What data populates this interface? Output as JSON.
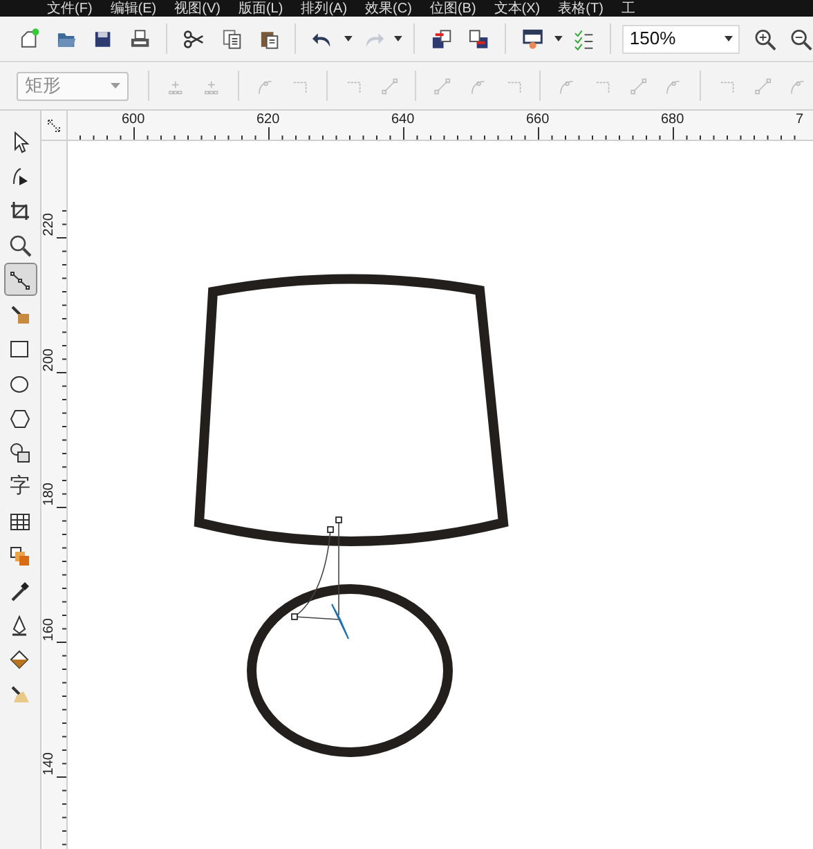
{
  "menu_bar": {
    "items": [
      "文件(F)",
      "编辑(E)",
      "视图(V)",
      "版面(L)",
      "排列(A)",
      "效果(C)",
      "位图(B)",
      "文本(X)",
      "表格(T)",
      "工"
    ]
  },
  "standard_toolbar": {
    "zoom": "150%"
  },
  "property_bar": {
    "shape": "矩形"
  },
  "horizontal_ruler": {
    "labels": [
      "600",
      "620",
      "640",
      "660",
      "680",
      "7"
    ]
  },
  "vertical_ruler": {
    "labels": [
      "220",
      "200",
      "180",
      "160",
      "140"
    ]
  },
  "toolbox": {
    "items": [
      {
        "kind": "icon",
        "selected": false
      },
      {
        "kind": "icon",
        "selected": false
      },
      {
        "kind": "icon",
        "selected": false
      },
      {
        "kind": "icon",
        "selected": false
      },
      {
        "kind": "icon",
        "selected": true
      },
      {
        "kind": "icon",
        "selected": false
      },
      {
        "kind": "icon",
        "selected": false
      },
      {
        "kind": "icon",
        "selected": false
      },
      {
        "kind": "icon",
        "selected": false
      },
      {
        "kind": "icon",
        "selected": false
      },
      {
        "kind": "glyph",
        "label": "字",
        "selected": false
      },
      {
        "kind": "icon",
        "selected": false
      },
      {
        "kind": "icon",
        "selected": false
      },
      {
        "kind": "icon",
        "selected": false
      },
      {
        "kind": "icon",
        "selected": false
      },
      {
        "kind": "icon",
        "selected": false
      },
      {
        "kind": "icon",
        "selected": false
      }
    ]
  }
}
